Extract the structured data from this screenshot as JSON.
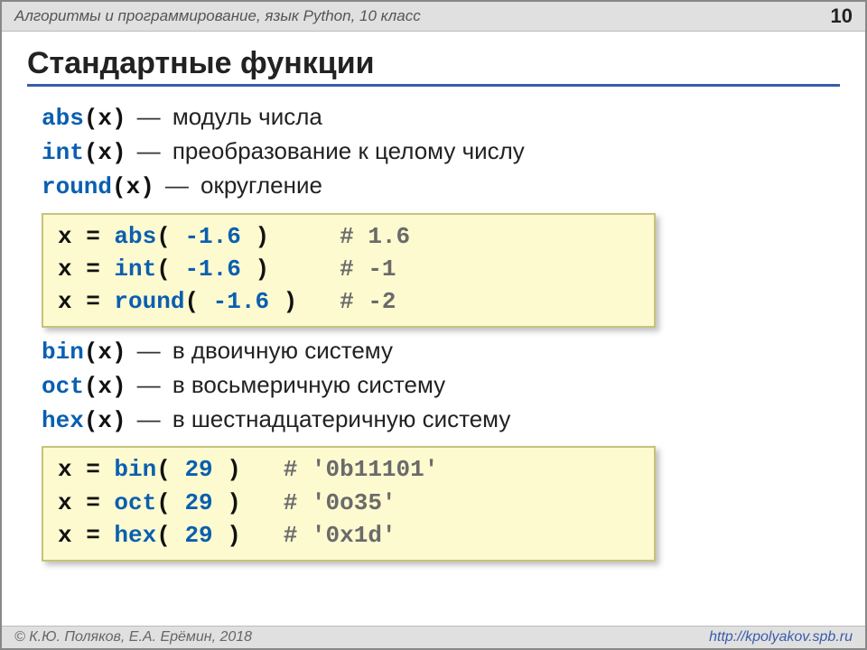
{
  "header": {
    "subject": "Алгоритмы и программирование, язык Python, 10 класс",
    "page": "10"
  },
  "title": "Стандартные функции",
  "defs1": [
    {
      "fn": "abs",
      "arg": "(x)",
      "dash": "—",
      "desc": "модуль числа"
    },
    {
      "fn": "int",
      "arg": "(x)",
      "dash": "—",
      "desc": "преобразование к целому числу"
    },
    {
      "fn": "round",
      "arg": "(x)",
      "dash": "—",
      "desc": "округление"
    }
  ],
  "code1": [
    {
      "lhs": "x = ",
      "fn": "abs",
      "args": "( -1.6 )",
      "pad": "     ",
      "cmt": "# 1.6"
    },
    {
      "lhs": "x = ",
      "fn": "int",
      "args": "( -1.6 )",
      "pad": "     ",
      "cmt": "# -1"
    },
    {
      "lhs": "x = ",
      "fn": "round",
      "args": "( -1.6 )",
      "pad": "   ",
      "cmt": "# -2"
    }
  ],
  "defs2": [
    {
      "fn": "bin",
      "arg": "(x)",
      "dash": "—",
      "desc": "в двоичную систему"
    },
    {
      "fn": "oct",
      "arg": "(x)",
      "dash": "—",
      "desc": "в восьмеричную систему"
    },
    {
      "fn": "hex",
      "arg": "(x)",
      "dash": "—",
      "desc": "в шестнадцатеричную систему"
    }
  ],
  "code2": [
    {
      "lhs": "x = ",
      "fn": "bin",
      "args": "( 29 )",
      "pad": "   ",
      "cmt": "# '0b11101'"
    },
    {
      "lhs": "x = ",
      "fn": "oct",
      "args": "( 29 )",
      "pad": "   ",
      "cmt": "# '0o35'"
    },
    {
      "lhs": "x = ",
      "fn": "hex",
      "args": "( 29 )",
      "pad": "   ",
      "cmt": "# '0x1d'"
    }
  ],
  "footer": {
    "copyright": "© К.Ю. Поляков, Е.А. Ерёмин, 2018",
    "url": "http://kpolyakov.spb.ru"
  }
}
